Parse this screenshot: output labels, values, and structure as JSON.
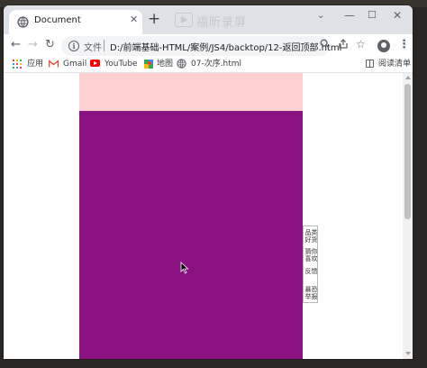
{
  "tab": {
    "title": "Document",
    "favicon": "globe-icon"
  },
  "watermark": {
    "text": "福昕录屏"
  },
  "address": {
    "file_label": "文件",
    "url": "D:/前端基础-HTML/案例/JS4/backtop/12-返回顶部.html"
  },
  "bookmarks": {
    "items": [
      {
        "label": "应用",
        "icon": "apps-grid-icon"
      },
      {
        "label": "Gmail",
        "icon": "gmail-icon"
      },
      {
        "label": "YouTube",
        "icon": "youtube-icon"
      },
      {
        "label": "地图",
        "icon": "maps-icon"
      },
      {
        "label": "07-次序.html",
        "icon": "globe-icon"
      }
    ],
    "reading_list": "阅读清单"
  },
  "side_panel": {
    "links": [
      "品类好货",
      "猜你喜欢",
      "反馈",
      "暴恐举报"
    ]
  },
  "colors": {
    "pink_block": "#ffd0d0",
    "purple_block": "#8b1280",
    "tabstrip": "#dee1e6"
  }
}
